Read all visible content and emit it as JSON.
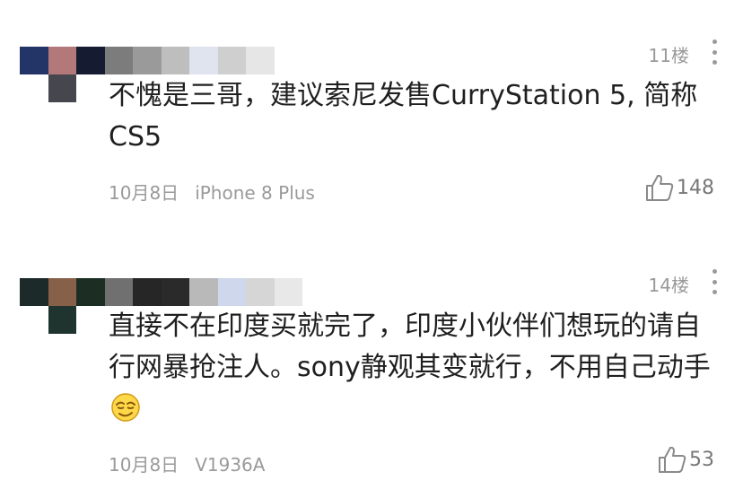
{
  "comments": [
    {
      "floor": "11楼",
      "text": "不愧是三哥，建议索尼发售CurryStation 5, 简称CS5",
      "date": "10月8日",
      "device": "iPhone 8 Plus",
      "likes": "148",
      "avatar_colors": {
        "row1": [
          "#233566",
          "#b3787a",
          "#151c32",
          "#7c7c7c",
          "#9a9a9a",
          "#bebebe",
          "#dfe4ee",
          "#cfcfcf",
          "#e6e6e6"
        ],
        "row2": [
          "#46464e"
        ]
      }
    },
    {
      "floor": "14楼",
      "text": "直接不在印度买就完了，印度小伙伴们想玩的请自行网暴抢注人。sony静观其变就行，不用自己动手",
      "emoji": "smirk-face-emoji",
      "date": "10月8日",
      "device": "V1936A",
      "likes": "53",
      "avatar_colors": {
        "row1": [
          "#1c2a2a",
          "#87604a",
          "#1c2e24",
          "#707070",
          "#262626",
          "#2a2a2a",
          "#b9b9b9",
          "#cfd7ec",
          "#d6d6d6",
          "#e8e8e8"
        ],
        "row2": [
          "#1f342e"
        ]
      }
    }
  ]
}
